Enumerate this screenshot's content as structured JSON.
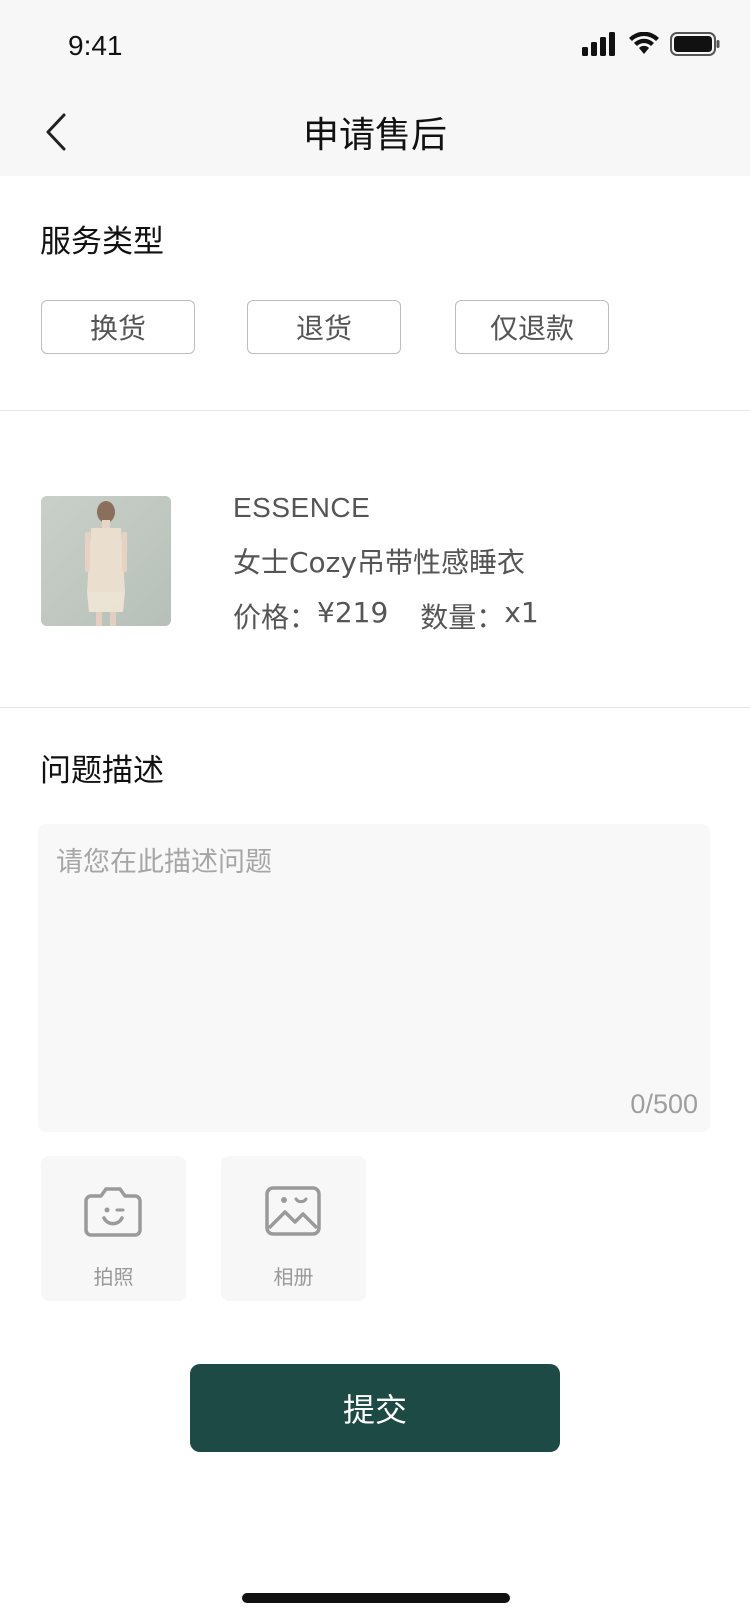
{
  "status_bar": {
    "time": "9:41"
  },
  "nav": {
    "title": "申请售后"
  },
  "service_type": {
    "title": "服务类型",
    "options": [
      "换货",
      "退货",
      "仅退款"
    ]
  },
  "product": {
    "brand": "ESSENCE",
    "name": "女士Cozy吊带性感睡衣",
    "price_label": "价格：",
    "price": "¥219",
    "qty_label": "数量：",
    "qty": "x1"
  },
  "problem": {
    "title": "问题描述",
    "placeholder": "请您在此描述问题",
    "counter": "0/500"
  },
  "uploads": {
    "camera_label": "拍照",
    "album_label": "相册"
  },
  "submit_label": "提交",
  "colors": {
    "primary": "#1e4a45",
    "border": "#bdbdbd",
    "muted": "#a6a6a6"
  }
}
